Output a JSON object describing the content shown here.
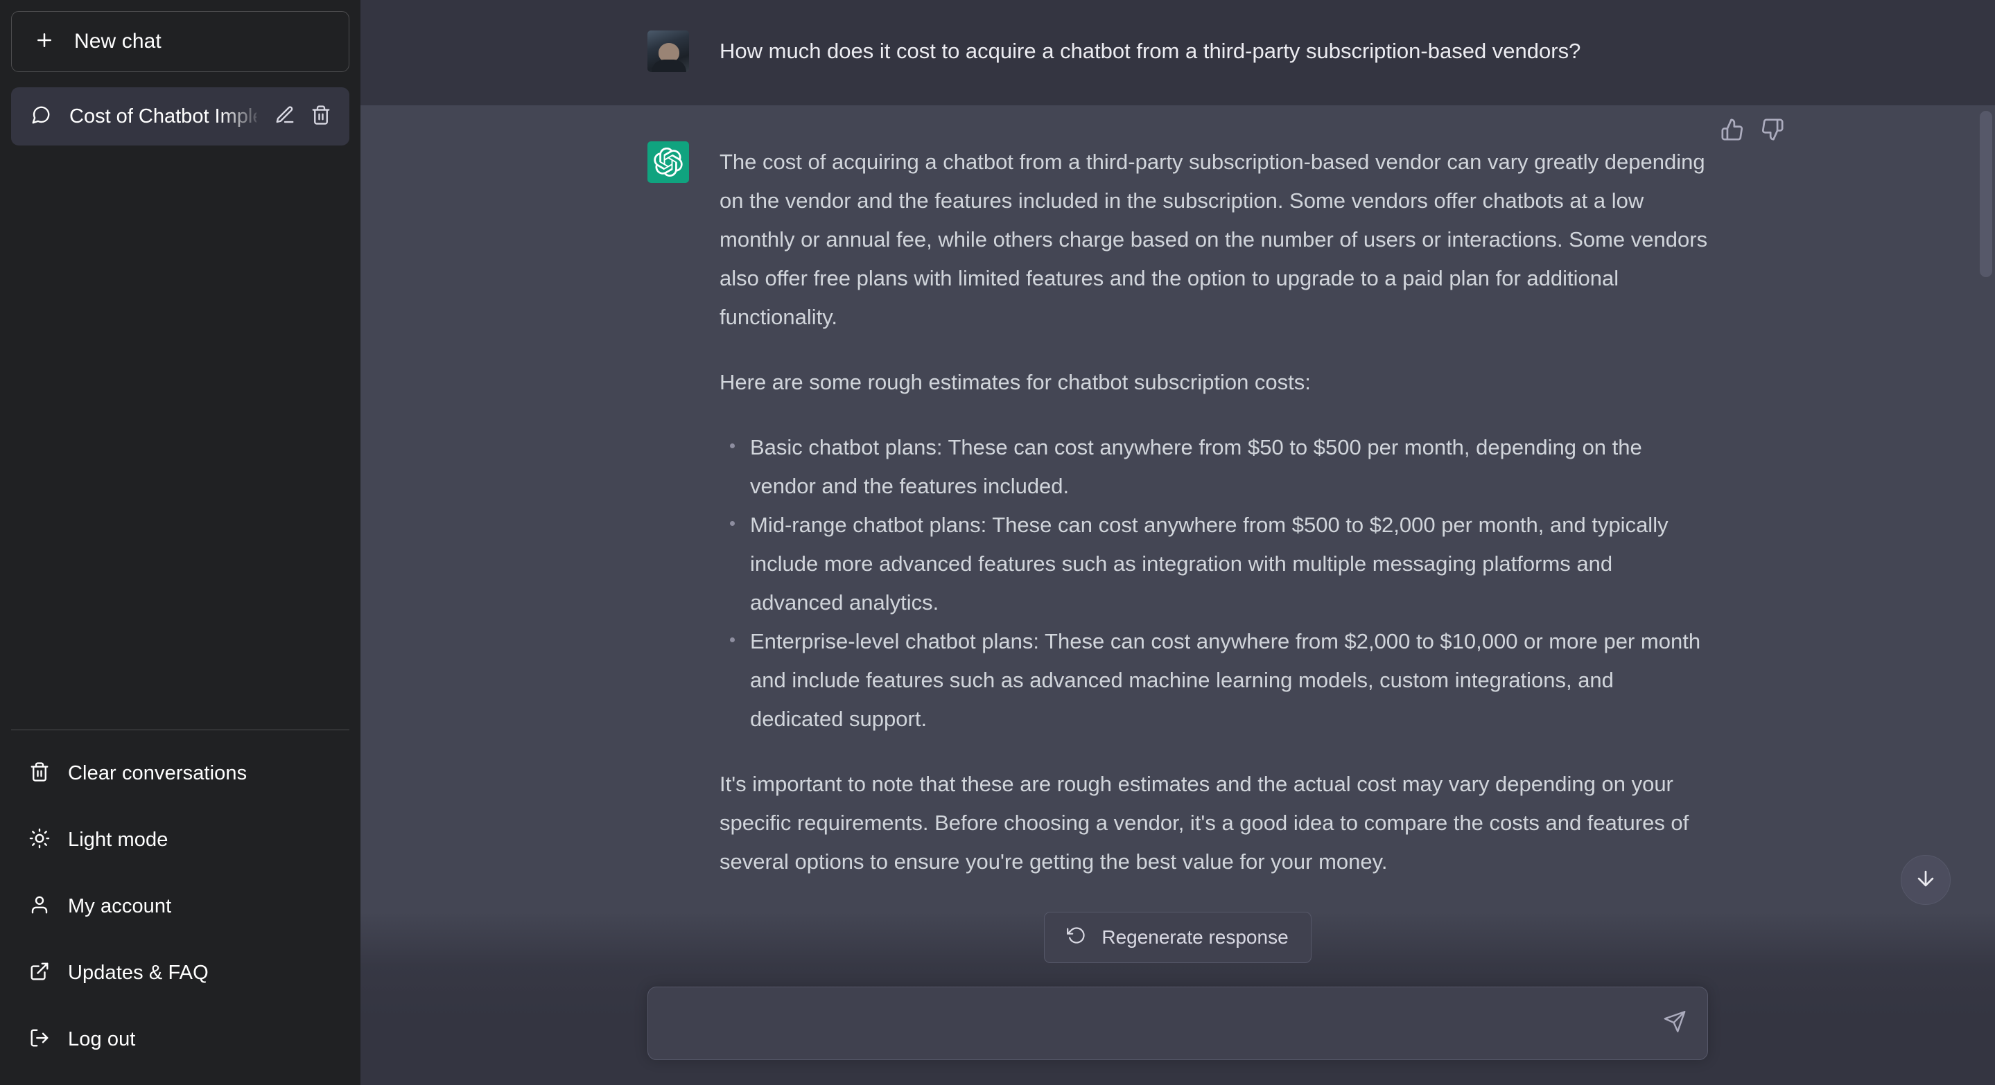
{
  "sidebar": {
    "new_chat_label": "New chat",
    "conversations": [
      {
        "title": "Cost of Chatbot Imple",
        "icon": "message-square-icon",
        "active": true
      }
    ],
    "footer_items": [
      {
        "label": "Clear conversations",
        "icon": "trash-icon"
      },
      {
        "label": "Light mode",
        "icon": "sun-icon"
      },
      {
        "label": "My account",
        "icon": "user-icon"
      },
      {
        "label": "Updates & FAQ",
        "icon": "external-link-icon"
      },
      {
        "label": "Log out",
        "icon": "logout-icon"
      }
    ]
  },
  "conversation": {
    "messages": [
      {
        "role": "user",
        "avatar": "user-photo-avatar",
        "paragraphs": [
          "How much does it cost to acquire a chatbot from a third-party subscription-based vendors?"
        ]
      },
      {
        "role": "assistant",
        "avatar": "openai-logo-avatar",
        "paragraphs": [
          "The cost of acquiring a chatbot from a third-party subscription-based vendor can vary greatly depending on the vendor and the features included in the subscription. Some vendors offer chatbots at a low monthly or annual fee, while others charge based on the number of users or interactions. Some vendors also offer free plans with limited features and the option to upgrade to a paid plan for additional functionality.",
          "Here are some rough estimates for chatbot subscription costs:"
        ],
        "bullets": [
          "Basic chatbot plans: These can cost anywhere from $50 to $500 per month, depending on the vendor and the features included.",
          "Mid-range chatbot plans: These can cost anywhere from $500 to $2,000 per month, and typically include more advanced features such as integration with multiple messaging platforms and advanced analytics.",
          "Enterprise-level chatbot plans: These can cost anywhere from $2,000 to $10,000 or more per month and include features such as advanced machine learning models, custom integrations, and dedicated support."
        ],
        "closing_paragraphs": [
          "It's important to note that these are rough estimates and the actual cost may vary depending on your specific requirements. Before choosing a vendor, it's a good idea to compare the costs and features of several options to ensure you're getting the best value for your money."
        ],
        "feedback": {
          "thumbs_up": "thumbs-up-icon",
          "thumbs_down": "thumbs-down-icon"
        }
      }
    ]
  },
  "composer": {
    "regenerate_label": "Regenerate response",
    "input_value": "",
    "input_placeholder": "",
    "send_icon": "send-icon"
  },
  "scroll_to_bottom": {
    "icon": "arrow-down-icon"
  },
  "colors": {
    "sidebar_bg": "#202123",
    "user_msg_bg": "#343541",
    "assistant_msg_bg": "#444654",
    "accent_green": "#10a37f",
    "text_primary": "#ececf1",
    "text_body": "#d1d5db",
    "border": "#565869"
  }
}
